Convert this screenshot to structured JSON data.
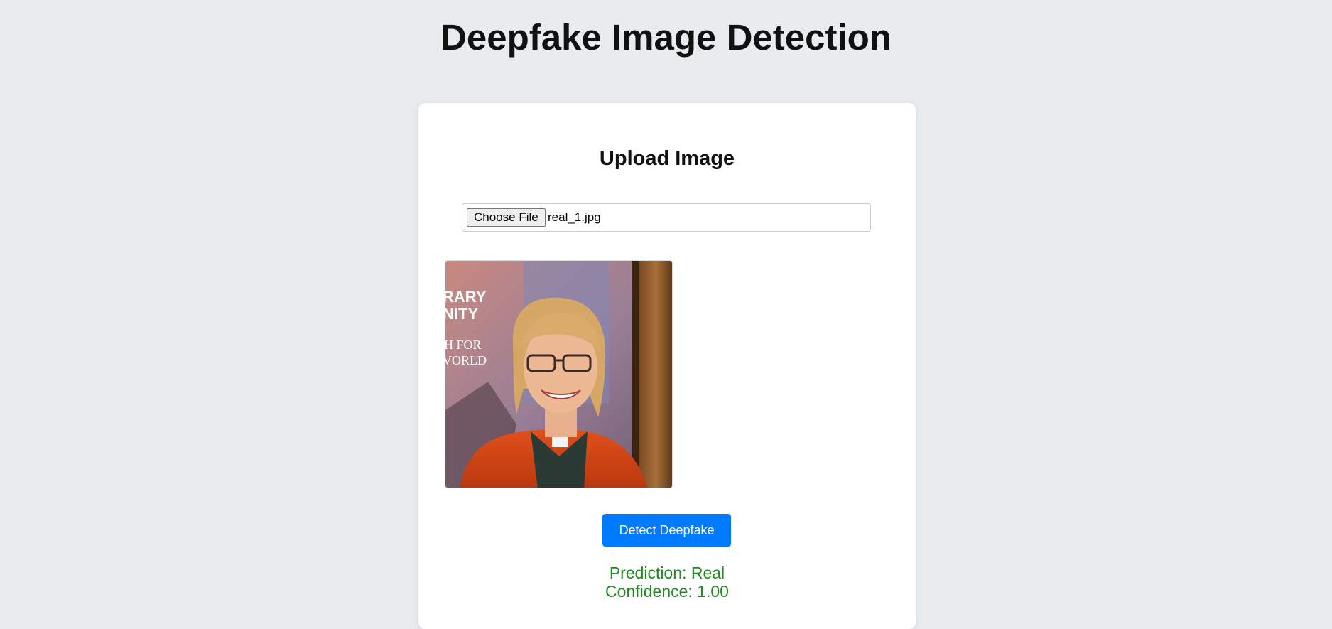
{
  "page": {
    "title": "Deepfake Image Detection"
  },
  "upload": {
    "heading": "Upload Image",
    "choose_label": "Choose File",
    "file_name": "real_1.jpg",
    "preview_text_lines": [
      "RARY",
      "NITY",
      "H FOR",
      "VORLD"
    ]
  },
  "actions": {
    "detect_label": "Detect Deepfake"
  },
  "result": {
    "prediction": "Prediction: Real",
    "confidence": "Confidence: 1.00"
  },
  "colors": {
    "background": "#e8ecee",
    "card": "#ffffff",
    "accent": "#007bff",
    "result_text": "#1f8a1f"
  }
}
